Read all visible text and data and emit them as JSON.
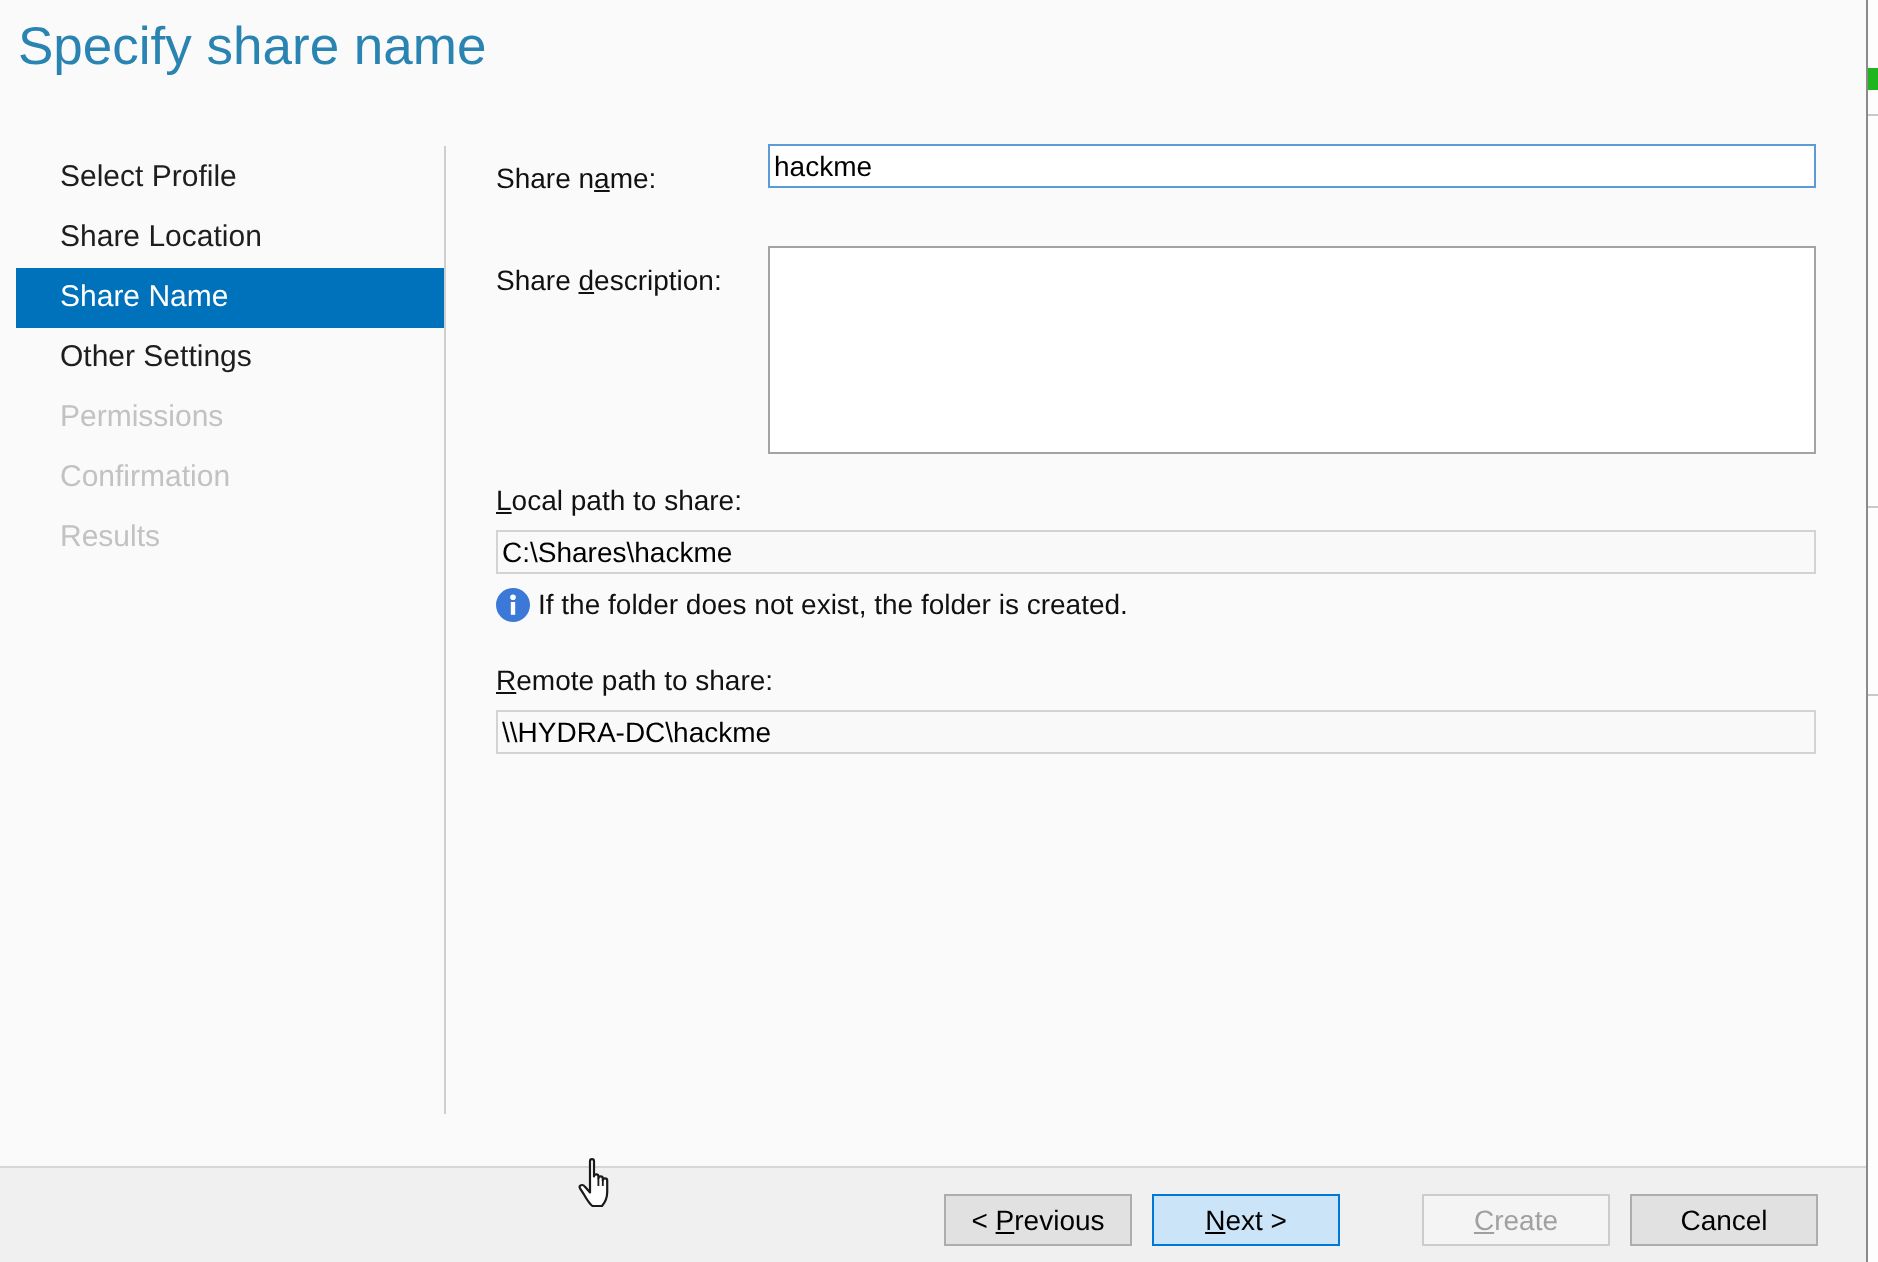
{
  "window": {
    "title": "Specify share name"
  },
  "steps": [
    {
      "label": "Select Profile",
      "selected": false,
      "disabled": false
    },
    {
      "label": "Share Location",
      "selected": false,
      "disabled": false
    },
    {
      "label": "Share Name",
      "selected": true,
      "disabled": false
    },
    {
      "label": "Other Settings",
      "selected": false,
      "disabled": false
    },
    {
      "label": "Permissions",
      "selected": false,
      "disabled": true
    },
    {
      "label": "Confirmation",
      "selected": false,
      "disabled": true
    },
    {
      "label": "Results",
      "selected": false,
      "disabled": true
    }
  ],
  "fields": [
    {
      "kind": "text",
      "label": {
        "before": "Share n",
        "access_key": "a",
        "after": "me:"
      },
      "value": "hackme",
      "focused": true
    },
    {
      "kind": "textarea",
      "label": {
        "before": "Share ",
        "access_key": "d",
        "after": "escription:"
      },
      "focused": false
    },
    {
      "kind": "readonly",
      "label": {
        "access_key": "L",
        "after": "ocal path to share:"
      },
      "value": "C:\\Shares\\hackme",
      "note": "If the folder does not exist, the folder is created."
    },
    {
      "kind": "readonly",
      "label": {
        "access_key": "R",
        "after": "emote path to share:"
      },
      "value": "\\\\HYDRA-DC\\hackme"
    }
  ],
  "nav_buttons": [
    {
      "label": {
        "before": "< ",
        "access_key": "P",
        "after": "revious"
      },
      "default": false,
      "disabled": false
    },
    {
      "label": {
        "access_key": "N",
        "after": "ext >"
      },
      "default": true,
      "disabled": false
    }
  ],
  "action_buttons": [
    {
      "label": {
        "access_key": "C",
        "after": "reate"
      },
      "default": false,
      "disabled": true
    },
    {
      "label": "Cancel",
      "default": false,
      "disabled": false
    }
  ]
}
